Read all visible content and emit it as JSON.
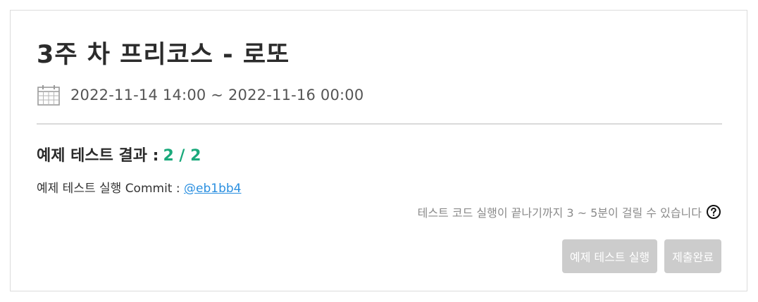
{
  "title": "3주 차 프리코스 - 로또",
  "period": {
    "icon": "calendar-icon",
    "text": "2022-11-14 14:00 ~ 2022-11-16 00:00"
  },
  "result": {
    "label": "예제 테스트 결과 :",
    "score": "2 / 2",
    "score_color": "#1aa97b"
  },
  "commit": {
    "label": "예제 테스트 실행 Commit :",
    "link": "@eb1bb4",
    "link_color": "#2a8fe0"
  },
  "notice": {
    "text": "테스트 코드 실행이 끝나기까지 3 ~ 5분이 걸릴 수 있습니다",
    "icon": "help-circle-icon"
  },
  "buttons": {
    "run_test": "예제 테스트 실행",
    "submit": "제출완료",
    "color": "#cccccc"
  }
}
